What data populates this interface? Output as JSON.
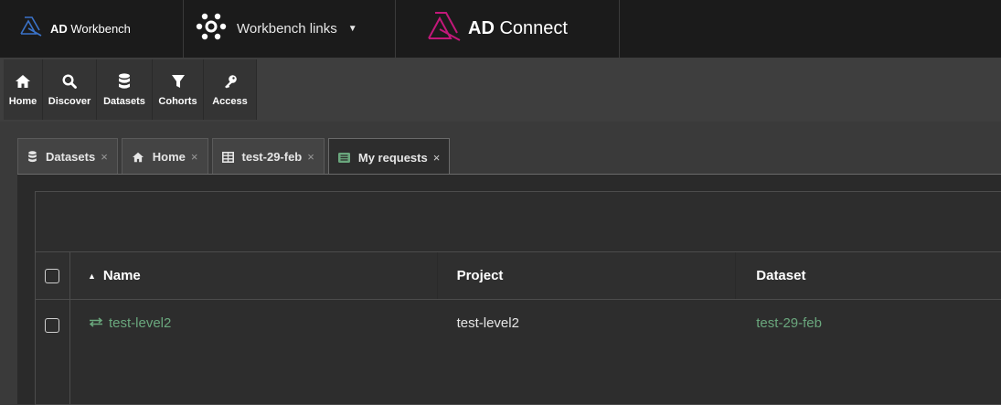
{
  "brand": {
    "bold": "AD",
    "rest": " Workbench"
  },
  "workbench_links": {
    "label": "Workbench links"
  },
  "connect": {
    "bold": "AD",
    "rest": " Connect"
  },
  "nav": [
    {
      "label": "Home",
      "icon": "home-icon"
    },
    {
      "label": "Discover",
      "icon": "search-icon"
    },
    {
      "label": "Datasets",
      "icon": "database-icon"
    },
    {
      "label": "Cohorts",
      "icon": "filter-icon"
    },
    {
      "label": "Access",
      "icon": "key-icon"
    }
  ],
  "tabs": [
    {
      "label": "Datasets",
      "icon": "database-icon",
      "close": "×"
    },
    {
      "label": "Home",
      "icon": "home-icon",
      "close": "×"
    },
    {
      "label": "test-29-feb",
      "icon": "table-icon",
      "close": "×"
    },
    {
      "label": "My requests",
      "icon": "list-icon",
      "close": "×",
      "active": true
    }
  ],
  "table": {
    "columns": [
      "Name",
      "Project",
      "Dataset"
    ],
    "sort_indicator": "▲",
    "rows": [
      {
        "name": "test-level2",
        "project": "test-level2",
        "dataset": "test-29-feb"
      }
    ]
  },
  "colors": {
    "link": "#6aa77d",
    "connect_logo": "#c2187a",
    "brand_logo": "#3b73c9"
  }
}
